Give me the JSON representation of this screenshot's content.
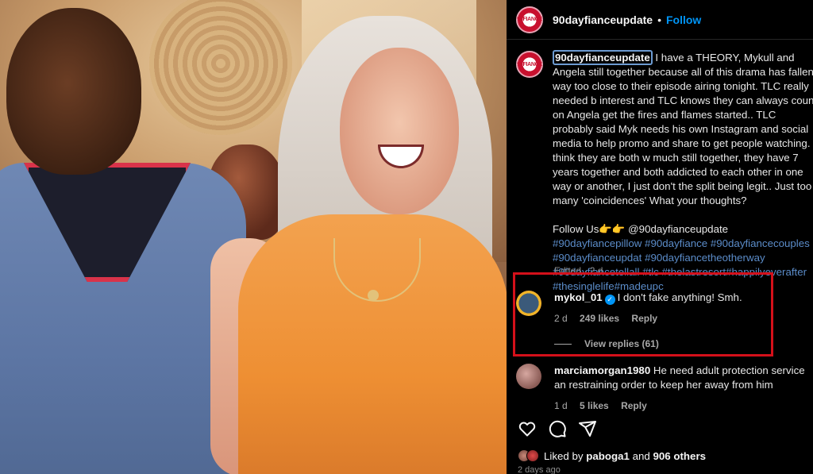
{
  "header": {
    "username": "90dayfianceupdate",
    "separator": "•",
    "follow_label": "Follow",
    "avatar_text": "90FIANCE"
  },
  "caption": {
    "username": "90dayfianceupdate",
    "text": " I have a THEORY, Mykull and Angela still together because all of this drama has fallen way too close to their episode airing tonight. TLC really needed b interest and TLC knows they can always count on Angela get the fires and flames started.. TLC probably said Myk needs his own Instagram and social media to help promo and share to get people watching. I think they are both w much still together, they have 7 years together and both addicted to each other in one way or another, I just don't the split being legit.. Just too many 'coincidences' What your thoughts?",
    "follow_line": "Follow Us👉👉 @90dayfianceupdate ",
    "hashtags": "#90dayfiancepillow #90dayfiance #90dayfiancecouples #90dayfianceupdat #90dayfiancetheotherway #90dayfiancetellall #tlc #thelastresort#happilyeverafter #thesinglelife#madeupc",
    "edited": "Edited · 2 d"
  },
  "comments": [
    {
      "username": "mykol_01",
      "text": "I don't fake anything! Smh.",
      "time": "2 d",
      "likes": "249 likes",
      "reply": "Reply",
      "view_replies": "View replies (61)",
      "verified": true
    },
    {
      "username": "marciamorgan1980",
      "text": "He need adult protection service an restraining order to keep her away from him",
      "time": "1 d",
      "likes": "5 likes",
      "reply": "Reply"
    }
  ],
  "footer": {
    "liked_by_prefix": "Liked by ",
    "liked_by_user": "paboga1",
    "liked_by_and": " and ",
    "liked_by_count": "906 others",
    "time": "2 days ago"
  },
  "colors": {
    "accent": "#0095f6",
    "highlight": "#d4101a",
    "hashtag": "#5b8cc9"
  },
  "icons": [
    "heart-icon",
    "comment-icon",
    "share-icon",
    "verified-icon"
  ]
}
